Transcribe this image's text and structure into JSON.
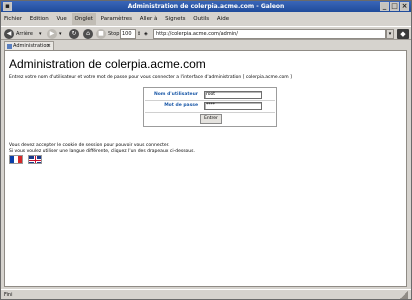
{
  "window": {
    "title": "Administration de colerpia.acme.com - Galeon"
  },
  "menubar": {
    "items": [
      "Fichier",
      "Edition",
      "Vue",
      "Onglet",
      "Paramètres",
      "Aller à",
      "Signets",
      "Outils",
      "Aide"
    ]
  },
  "toolbar": {
    "back_label": "Arrière",
    "stop_label": "Stop",
    "zoom_value": "100",
    "url": "http://colerpia.acme.com/admin/"
  },
  "tab": {
    "label": "Administration a"
  },
  "page": {
    "title": "Administration de colerpia.acme.com",
    "intro": "Entrez votre nom d'utilisateur et votre mot de passe pour vous connecter a l'interface d'administration [ colerpia.acme.com ]",
    "form": {
      "username_label": "Nom d'utilisateur",
      "username_value": "root",
      "password_label": "Mot de passe",
      "password_value": "****",
      "submit_label": "Entrer"
    },
    "note_line1": "Vous devez accepter le cookie de session pour pouvoir vous connecter.",
    "note_line2": "Si vous voulez utiliser une langue différente, cliquez l'un des drapeaux ci-dessous."
  },
  "statusbar": {
    "text": "Fini"
  }
}
